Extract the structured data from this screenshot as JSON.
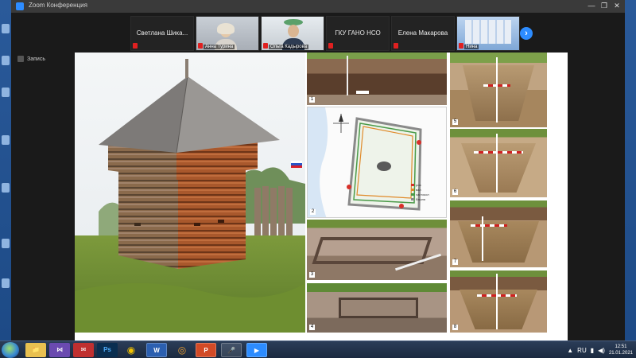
{
  "window": {
    "title": "Zoom Конференция",
    "controls": [
      "—",
      "❐",
      "✕"
    ]
  },
  "participants": [
    {
      "name": "Светлана  Шика...",
      "type": "name",
      "muted": true
    },
    {
      "name": "",
      "caption": "Анна Турина",
      "type": "video",
      "muted": true
    },
    {
      "name": "",
      "caption": "Ольга Кадырова",
      "type": "video",
      "muted": true
    },
    {
      "name": "ГКУ ГАНО НСО",
      "type": "name",
      "muted": true
    },
    {
      "name": "Елена Макарова",
      "type": "name",
      "muted": true
    },
    {
      "name": "",
      "caption": "Нина",
      "type": "video",
      "muted": true
    }
  ],
  "next_page_icon": "chevron-right-icon",
  "recording": {
    "label": "Запись"
  },
  "slide": {
    "panel_labels": [
      "1",
      "2",
      "3",
      "4",
      "5",
      "6",
      "7",
      "8"
    ],
    "map_legend": [
      "ров",
      "вал",
      "частокол",
      "башня"
    ]
  },
  "taskbar": {
    "apps": [
      {
        "icon": "folder-icon",
        "glyph": "📁"
      },
      {
        "icon": "visual-studio-icon",
        "glyph": "⋈"
      },
      {
        "icon": "mail-icon",
        "glyph": "✉"
      },
      {
        "icon": "photoshop-icon",
        "glyph": "Ps"
      },
      {
        "icon": "chrome-icon",
        "glyph": "◉"
      },
      {
        "icon": "word-icon",
        "glyph": "W"
      },
      {
        "icon": "unknown-app-icon",
        "glyph": "◎"
      },
      {
        "icon": "powerpoint-icon",
        "glyph": "P"
      },
      {
        "icon": "microphone-icon",
        "glyph": "🎤"
      },
      {
        "icon": "zoom-icon",
        "glyph": "▶"
      }
    ],
    "tray": {
      "language": "RU",
      "time": "12:51",
      "date": "21.01.2021"
    }
  }
}
